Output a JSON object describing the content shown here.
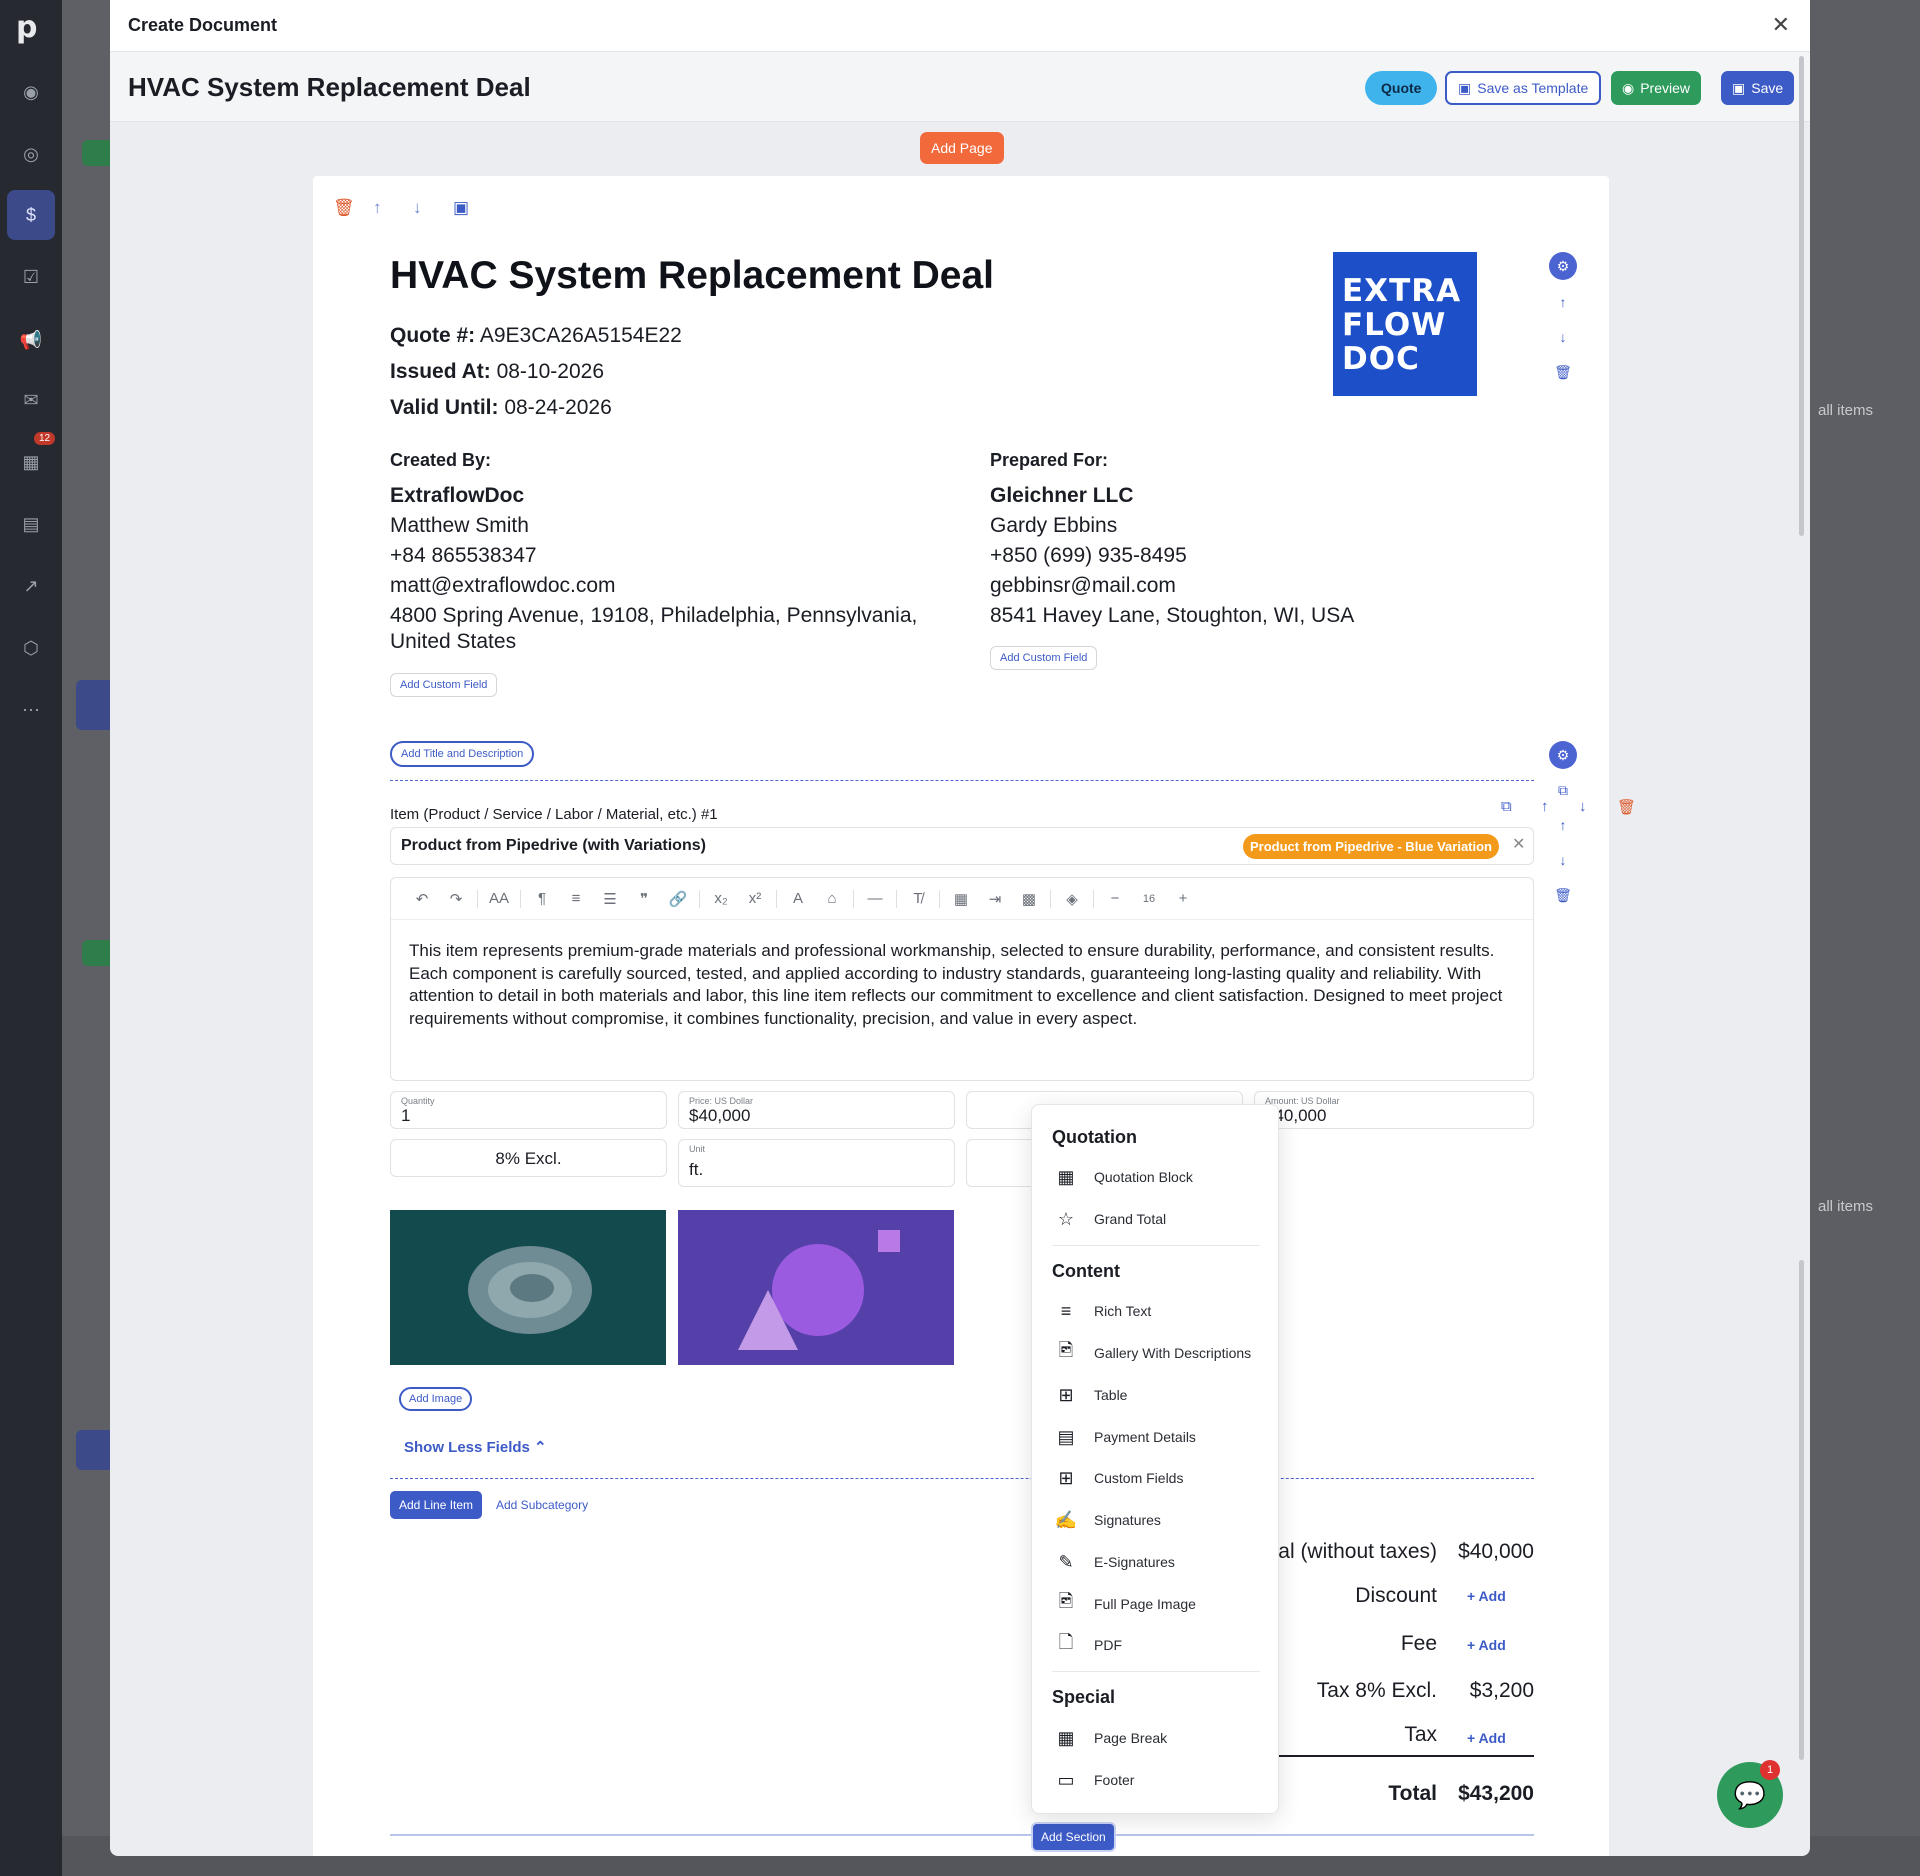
{
  "modal": {
    "title": "Create Document",
    "close": "✕"
  },
  "doc_bar": {
    "title": "HVAC System Replacement Deal",
    "quote_label": "Quote",
    "save_template_label": "Save as Template",
    "preview_label": "Preview",
    "save_label": "Save"
  },
  "add_page_label": "Add Page",
  "document": {
    "heading": "HVAC System Replacement Deal",
    "quote_number_label": "Quote #:",
    "quote_number": "A9E3CA26A5154E22",
    "issued_label": "Issued At:",
    "issued": "08-10-2026",
    "valid_label": "Valid Until:",
    "valid": "08-24-2026",
    "logo_text": [
      "EXTRA",
      "FLOW",
      "DOC"
    ]
  },
  "created_by": {
    "label": "Created By:",
    "company": "ExtraflowDoc",
    "person": "Matthew Smith",
    "phone": "+84 865538347",
    "email": "matt@extraflowdoc.com",
    "address": "4800 Spring Avenue, 19108, Philadelphia, Pennsylvania,",
    "address2": "United States",
    "add_field": "Add Custom Field"
  },
  "prepared_for": {
    "label": "Prepared For:",
    "company": "Gleichner LLC",
    "person": "Gardy Ebbins",
    "phone": "+850 (699) 935-8495",
    "email": "gebbinsr@mail.com",
    "address": "8541 Havey Lane, Stoughton, WI, USA",
    "add_field": "Add Custom Field"
  },
  "add_title_desc": "Add Title and Description",
  "item": {
    "label": "Item (Product / Service / Labor / Material, etc.) #1",
    "name": "Product from Pipedrive (with Variations)",
    "variation": "Product from Pipedrive - Blue Variation",
    "font_size": "16",
    "description": "This item represents premium-grade materials and professional workmanship, selected to ensure durability, performance, and consistent results. Each component is carefully sourced, tested, and applied according to industry standards, guaranteeing long-lasting quality and reliability. With attention to detail in both materials and labor, this line item reflects our commitment to excellence and client satisfaction. Designed to meet project requirements without compromise, it combines functionality, precision, and value in every aspect.",
    "quantity_label": "Quantity",
    "quantity": "1",
    "price_label": "Price: US Dollar",
    "price": "$40,000",
    "amount_label": "Amount: US Dollar",
    "amount": "$40,000",
    "tax": "8% Excl.",
    "unit_label": "Unit",
    "unit": "ft.",
    "add_image": "Add Image",
    "show_less": "Show Less Fields"
  },
  "add_line_item": "Add Line Item",
  "add_subcategory": "Add Subcategory",
  "totals": {
    "subtotal_label": "Subtotal (without taxes)",
    "subtotal": "$40,000",
    "discount_label": "Discount",
    "fee_label": "Fee",
    "tax_excl_label": "Tax 8% Excl.",
    "tax_excl": "$3,200",
    "tax_label": "Tax",
    "add": "Add",
    "total_label": "Total",
    "total": "$43,200"
  },
  "add_section": "Add Section",
  "dropdown": {
    "groups": {
      "quotation": "Quotation",
      "content": "Content",
      "special": "Special"
    },
    "items": {
      "quotation_block": "Quotation Block",
      "grand_total": "Grand Total",
      "rich_text": "Rich Text",
      "gallery": "Gallery With Descriptions",
      "table": "Table",
      "payment": "Payment Details",
      "custom_fields": "Custom Fields",
      "signatures": "Signatures",
      "e_signatures": "E-Signatures",
      "full_page_image": "Full Page Image",
      "pdf": "PDF",
      "page_break": "Page Break",
      "footer": "Footer"
    }
  },
  "background": {
    "rail_badge": "12",
    "all_items_1": "all items",
    "all_items_2": "all items"
  },
  "chat_badge": "1",
  "colors": {
    "accent": "#3d5bc7",
    "add_page": "#f26a3c",
    "preview": "#2e9b5c",
    "variation": "#f39a1a",
    "logo": "#1c4fc8"
  }
}
